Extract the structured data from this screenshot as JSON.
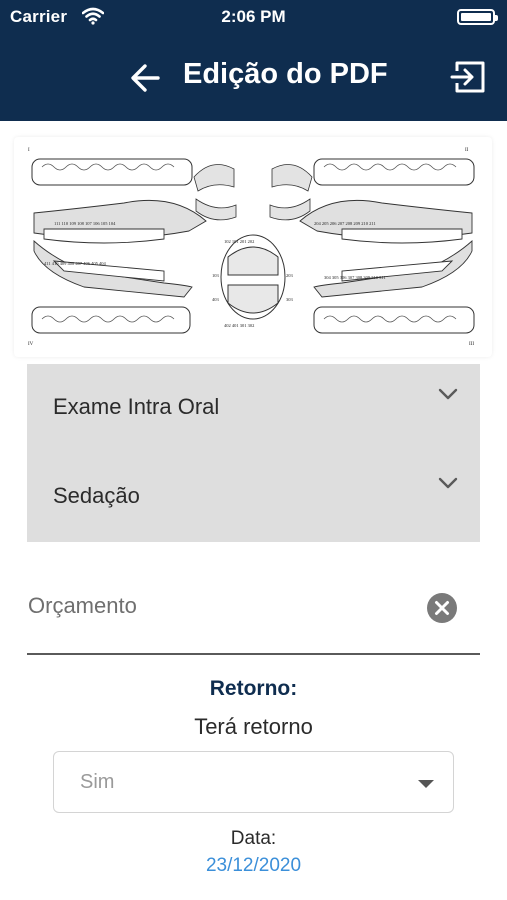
{
  "status_bar": {
    "carrier": "Carrier",
    "time": "2:06 PM"
  },
  "nav": {
    "title": "Edição do PDF",
    "back_icon": "arrow-left-icon",
    "exit_icon": "exit-icon"
  },
  "dental_chart": {
    "quadrants": [
      "I",
      "II",
      "III",
      "IV"
    ],
    "upper_left_numbers": [
      "111",
      "110",
      "109",
      "108",
      "107",
      "106",
      "105",
      "104"
    ],
    "upper_right_numbers": [
      "204",
      "205",
      "206",
      "207",
      "208",
      "209",
      "210",
      "211"
    ],
    "lower_left_numbers": [
      "411",
      "410",
      "409",
      "408",
      "407",
      "406",
      "405",
      "404"
    ],
    "lower_right_numbers": [
      "304",
      "305",
      "306",
      "307",
      "308",
      "309",
      "310",
      "311"
    ],
    "incisors_top": [
      "102",
      "101",
      "201",
      "202"
    ],
    "incisors_side": [
      "103",
      "203",
      "403",
      "303"
    ],
    "incisors_bottom": [
      "402",
      "401",
      "301",
      "302"
    ]
  },
  "accordion": {
    "items": [
      {
        "label": "Exame Intra Oral"
      },
      {
        "label": "Sedação"
      }
    ]
  },
  "orcamento": {
    "placeholder": "Orçamento"
  },
  "retorno": {
    "title": "Retorno:",
    "subtitle": "Terá retorno",
    "select_value": "Sim",
    "date_label": "Data:",
    "date_value": "23/12/2020"
  },
  "colors": {
    "nav_bg": "#0f2d4f",
    "accent_title": "#0f2d4f",
    "date_link": "#3b8fd9",
    "accordion_bg": "#dedede"
  }
}
